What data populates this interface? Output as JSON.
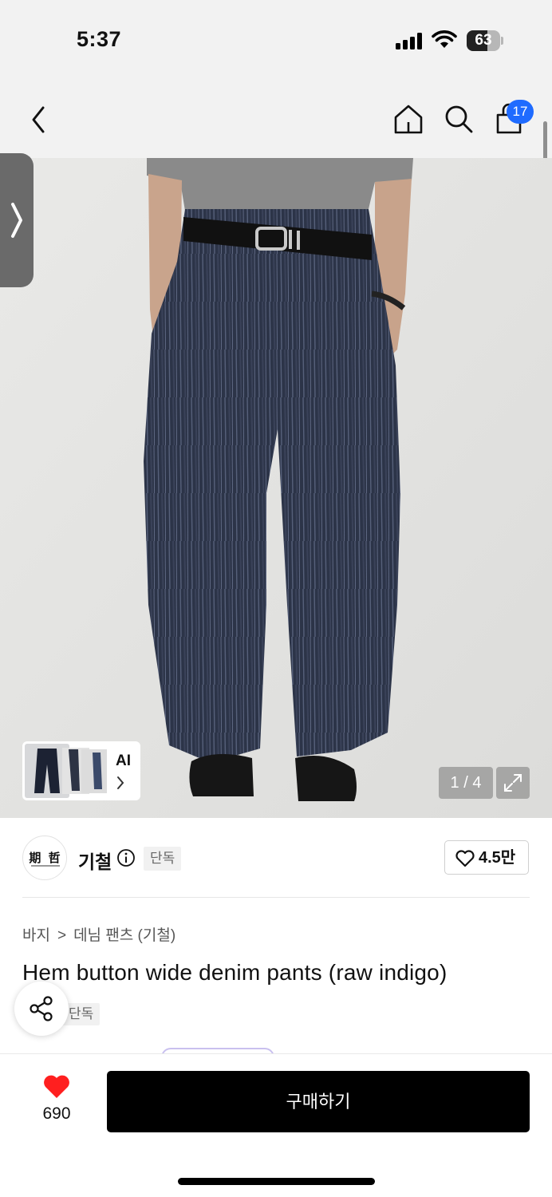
{
  "status_bar": {
    "time": "5:37",
    "battery": "63",
    "battery_level": 0.63
  },
  "nav": {
    "back_icon": "chevron-left-icon",
    "home_icon": "home-icon",
    "search_icon": "search-icon",
    "cart_icon": "shopping-bag-icon",
    "cart_badge": "17",
    "badge_color": "#1f6bff"
  },
  "gallery": {
    "side_tab_icon": "chevron-right-icon",
    "ai_label": "AI",
    "ai_chevron_icon": "chevron-right-icon",
    "pager": "1 / 4",
    "expand_icon": "expand-icon"
  },
  "brand": {
    "logo_text": "期 哲",
    "name": "기철",
    "info_icon": "info-icon",
    "tag": "단독",
    "likes": "4.5만",
    "like_icon": "heart-outline-icon"
  },
  "product": {
    "breadcrumb": [
      "바지",
      "데님 팬츠 (기철)"
    ],
    "breadcrumb_sep": ">",
    "title": "Hem button wide denim pants (raw indigo)",
    "tag": "단독",
    "share_icon": "share-icon"
  },
  "bottom_bar": {
    "wish_icon": "heart-filled-icon",
    "wish_color": "#ff1f1f",
    "wish_count": "690",
    "buy_label": "구매하기"
  }
}
